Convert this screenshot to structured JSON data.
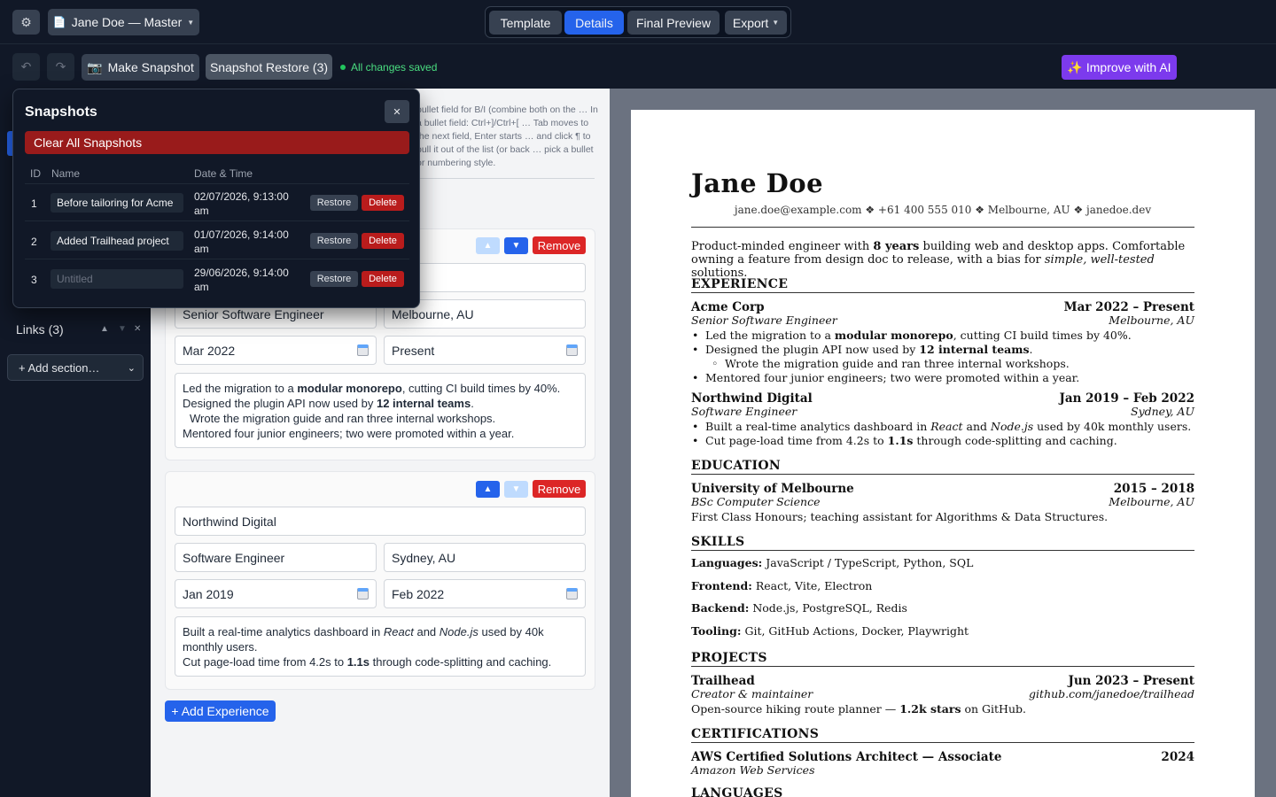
{
  "topbar": {
    "settings_icon": "gear-icon",
    "document_title": "Jane Doe — Master",
    "modes": [
      "Template",
      "Details",
      "Final Preview"
    ],
    "active_mode": "Details",
    "export_label": "Export"
  },
  "toolbar": {
    "make_snapshot": "Make Snapshot",
    "snapshot_restore": "Snapshot Restore (3)",
    "save_status": "All changes saved",
    "improve_ai": "Improve with AI",
    "accent_color": "#2563eb",
    "ai_color": "#7c3aed"
  },
  "sidebar": {
    "links_label": "Links (3)",
    "add_section_label": "+ Add section…"
  },
  "editor": {
    "help_text": "bullet field for B/I (combine both on the … In a bullet field: Ctrl+]/Ctrl+[ … Tab moves to the next field, Enter starts … and click ¶ to pull it out of the list (or back … pick a bullet or numbering style.",
    "remove_label": "Remove",
    "add_experience": "+ Add Experience",
    "experiences": [
      {
        "company": "",
        "title": "Senior Software Engineer",
        "location": "Melbourne, AU",
        "start": "Mar 2022",
        "end": "Present",
        "bullets": [
          "Led the migration to a modular monorepo, cutting CI build times by 40%.",
          "Designed the plugin API now used by 12 internal teams.",
          "Wrote the migration guide and ran three internal workshops.",
          "Mentored four junior engineers; two were promoted within a year."
        ]
      },
      {
        "company": "Northwind Digital",
        "title": "Software Engineer",
        "location": "Sydney, AU",
        "start": "Jan 2019",
        "end": "Feb 2022",
        "bullets": [
          "Built a real-time analytics dashboard in React and Node.js used by 40k monthly users.",
          "Cut page-load time from 4.2s to 1.1s through code-splitting and caching."
        ]
      }
    ]
  },
  "snapshots": {
    "title": "Snapshots",
    "clear_all": "Clear All Snapshots",
    "columns": [
      "ID",
      "Name",
      "Date & Time"
    ],
    "restore_label": "Restore",
    "delete_label": "Delete",
    "rows": [
      {
        "id": "1",
        "name": "Before tailoring for Acme",
        "date": "02/07/2026, 9:13:00",
        "time_suffix": "am"
      },
      {
        "id": "2",
        "name": "Added Trailhead project",
        "date": "01/07/2026, 9:14:00",
        "time_suffix": "am"
      },
      {
        "id": "3",
        "name": "",
        "placeholder": "Untitled",
        "date": "29/06/2026, 9:14:00",
        "time_suffix": "am"
      }
    ]
  },
  "resume": {
    "name": "Jane Doe",
    "contact": "jane.doe@example.com ❖ +61 400 555 010 ❖ Melbourne, AU ❖ janedoe.dev",
    "summary": "Product-minded engineer with 8 years building web and desktop apps. Comfortable owning a feature from design doc to release, with a bias for simple, well-tested solutions.",
    "sections": {
      "experience": "EXPERIENCE",
      "education": "EDUCATION",
      "skills": "SKILLS",
      "projects": "PROJECTS",
      "certifications": "CERTIFICATIONS",
      "languages": "LANGUAGES"
    },
    "experience": [
      {
        "org": "Acme Corp",
        "dates": "Mar 2022 – Present",
        "role": "Senior Software Engineer",
        "loc": "Melbourne, AU"
      },
      {
        "org": "Northwind Digital",
        "dates": "Jan 2019 – Feb 2022",
        "role": "Software Engineer",
        "loc": "Sydney, AU"
      }
    ],
    "exp_bullets": [
      "Led the migration to a modular monorepo, cutting CI build times by 40%.",
      "Designed the plugin API now used by 12 internal teams.",
      "Wrote the migration guide and ran three internal workshops.",
      "Mentored four junior engineers; two were promoted within a year.",
      "Built a real-time analytics dashboard in React and Node.js used by 40k monthly users.",
      "Cut page-load time from 4.2s to 1.1s through code-splitting and caching."
    ],
    "education": {
      "org": "University of Melbourne",
      "dates": "2015 – 2018",
      "degree": "BSc Computer Science",
      "loc": "Melbourne, AU",
      "note": "First Class Honours; teaching assistant for Algorithms & Data Structures."
    },
    "skills": [
      {
        "label": "Languages:",
        "value": "JavaScript / TypeScript, Python, SQL"
      },
      {
        "label": "Frontend:",
        "value": "React, Vite, Electron"
      },
      {
        "label": "Backend:",
        "value": "Node.js, PostgreSQL, Redis"
      },
      {
        "label": "Tooling:",
        "value": "Git, GitHub Actions, Docker, Playwright"
      }
    ],
    "project": {
      "name": "Trailhead",
      "dates": "Jun 2023 – Present",
      "role": "Creator & maintainer",
      "link": "github.com/janedoe/trailhead",
      "desc": "Open-source hiking route planner — 1.2k stars on GitHub."
    },
    "cert": {
      "name": "AWS Certified Solutions Architect — Associate",
      "year": "2024",
      "issuer": "Amazon Web Services"
    }
  }
}
